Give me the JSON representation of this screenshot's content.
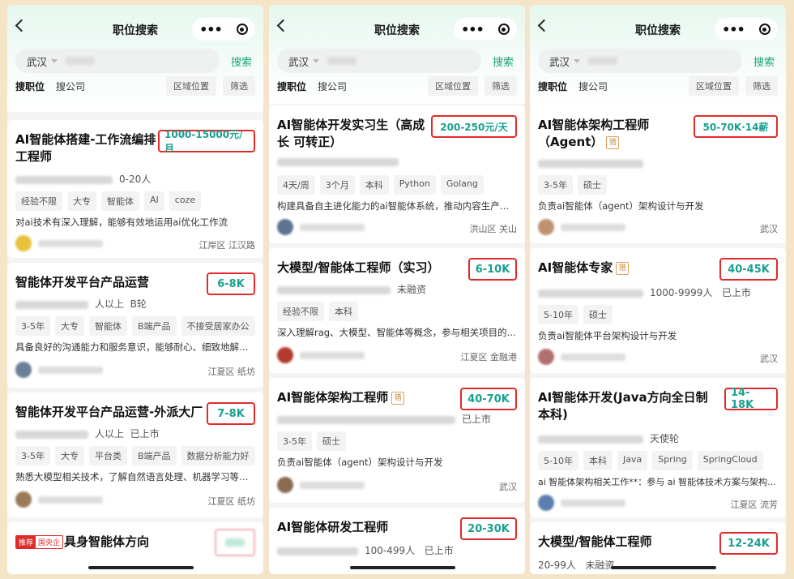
{
  "common": {
    "title": "职位搜索",
    "city": "武汉",
    "search_label": "搜索",
    "tab_job": "搜职位",
    "tab_company": "搜公司",
    "filter_area": "区域位置",
    "filter_more": "筛选"
  },
  "phone1": {
    "card1": {
      "title": "AI智能体搭建-工作流编排工程师",
      "salary": "1000-15000元/月",
      "meta": "0-20人",
      "tags": [
        "经验不限",
        "大专",
        "智能体",
        "AI",
        "coze"
      ],
      "desc": "对ai技术有深入理解，能够有效地运用ai优化工作流",
      "loc": "江岸区 江汉路"
    },
    "card2": {
      "title": "智能体开发平台产品运营",
      "salary": "6-8K",
      "meta_size": "人以上",
      "meta_stage": "B轮",
      "tags": [
        "3-5年",
        "大专",
        "智能体",
        "B端产品",
        "不接受居家办公"
      ],
      "desc": "具备良好的沟通能力和服务意识，能够耐心、细致地解答...",
      "loc": "江夏区 纸坊"
    },
    "card3": {
      "title": "智能体开发平台产品运营-外派大厂",
      "salary": "7-8K",
      "meta_size": "人以上",
      "meta_stage": "已上市",
      "tags": [
        "3-5年",
        "大专",
        "平台类",
        "B端产品",
        "数据分析能力好"
      ],
      "desc": "熟悉大模型相关技术，了解自然语言处理、机器学习等基...",
      "loc": "江夏区 纸坊"
    },
    "card4": {
      "badge1": "推荐",
      "badge2": "国央企",
      "title": "具身智能体方向"
    }
  },
  "phone2": {
    "card1": {
      "title": "AI智能体开发实习生（高成长 可转正）",
      "salary": "200-250元/天",
      "tags": [
        "4天/周",
        "3个月",
        "本科",
        "Python",
        "Golang"
      ],
      "desc": "构建具备自主进化能力的ai智能体系统，推动内容生产、...",
      "loc": "洪山区 关山"
    },
    "card2": {
      "title": "大模型/智能体工程师（实习）",
      "salary": "6-10K",
      "meta_stage": "未融资",
      "tags": [
        "经验不限",
        "本科"
      ],
      "desc": "深入理解rag、大模型、智能体等概念，参与相关项目的...",
      "loc": "江夏区 金融港"
    },
    "card3": {
      "title": "AI智能体架构工程师",
      "salary": "40-70K",
      "lie": "猎",
      "meta_stage": "已上市",
      "tags": [
        "3-5年",
        "硕士"
      ],
      "desc": "负责ai智能体（agent）架构设计与开发",
      "loc": "武汉"
    },
    "card4": {
      "title": "AI智能体研发工程师",
      "salary": "20-30K",
      "meta_size": "100-499人",
      "meta_stage": "已上市"
    }
  },
  "phone3": {
    "card1": {
      "title": "AI智能体架构工程师（Agent）",
      "salary": "50-70K·14薪",
      "lie": "猎",
      "tags": [
        "3-5年",
        "硕士"
      ],
      "desc": "负责ai智能体（agent）架构设计与开发",
      "loc": "武汉"
    },
    "card2": {
      "title": "AI智能体专家",
      "salary": "40-45K",
      "lie": "猎",
      "meta_size": "1000-9999人",
      "meta_stage": "已上市",
      "tags": [
        "5-10年",
        "硕士"
      ],
      "desc": "负责ai智能体平台架构设计与开发",
      "loc": "武汉"
    },
    "card3": {
      "title": "AI智能体开发(Java方向全日制本科)",
      "salary": "14-18K",
      "meta_stage": "天使轮",
      "tags": [
        "5-10年",
        "本科",
        "Java",
        "Spring",
        "SpringCloud"
      ],
      "desc": "ai 智能体架构相关工作**：参与 ai 智能体技术方案与架构...",
      "loc": "江夏区 流芳"
    },
    "card4": {
      "title": "大模型/智能体工程师",
      "salary": "12-24K",
      "meta_size": "20-99人",
      "meta_stage": "未融资"
    }
  },
  "colors": {
    "accent": "#18a090",
    "highlight_box": "#e12b2b",
    "search_text": "#1aa577"
  },
  "icons": [
    "back-icon",
    "more-dots-icon",
    "record-icon",
    "dropdown-arrow-icon"
  ]
}
